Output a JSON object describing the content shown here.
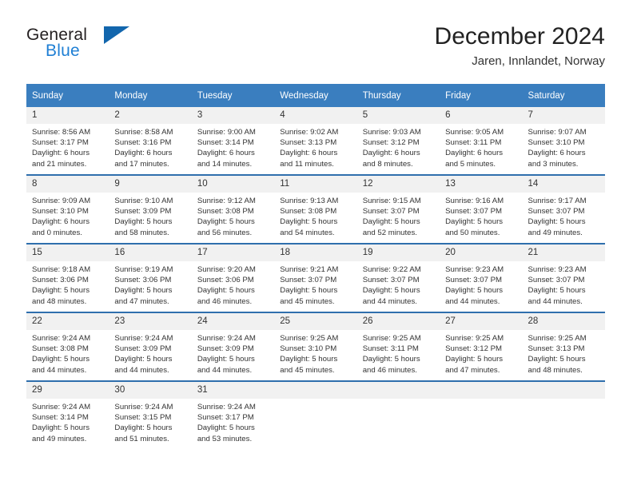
{
  "logo": {
    "text_top": "General",
    "text_bottom": "Blue",
    "triangle_icon": "blue-triangle-icon",
    "accent_color": "#1f7fd4"
  },
  "header": {
    "title": "December 2024",
    "subtitle": "Jaren, Innlandet, Norway"
  },
  "colors": {
    "header_row": "#3a7ebf",
    "week_divider": "#2f6fad",
    "daynum_band": "#f1f1f1",
    "text": "#333333"
  },
  "weekday_headers": [
    "Sunday",
    "Monday",
    "Tuesday",
    "Wednesday",
    "Thursday",
    "Friday",
    "Saturday"
  ],
  "weeks": [
    [
      {
        "day": "1",
        "sunrise": "Sunrise: 8:56 AM",
        "sunset": "Sunset: 3:17 PM",
        "daylight_line1": "Daylight: 6 hours",
        "daylight_line2": "and 21 minutes."
      },
      {
        "day": "2",
        "sunrise": "Sunrise: 8:58 AM",
        "sunset": "Sunset: 3:16 PM",
        "daylight_line1": "Daylight: 6 hours",
        "daylight_line2": "and 17 minutes."
      },
      {
        "day": "3",
        "sunrise": "Sunrise: 9:00 AM",
        "sunset": "Sunset: 3:14 PM",
        "daylight_line1": "Daylight: 6 hours",
        "daylight_line2": "and 14 minutes."
      },
      {
        "day": "4",
        "sunrise": "Sunrise: 9:02 AM",
        "sunset": "Sunset: 3:13 PM",
        "daylight_line1": "Daylight: 6 hours",
        "daylight_line2": "and 11 minutes."
      },
      {
        "day": "5",
        "sunrise": "Sunrise: 9:03 AM",
        "sunset": "Sunset: 3:12 PM",
        "daylight_line1": "Daylight: 6 hours",
        "daylight_line2": "and 8 minutes."
      },
      {
        "day": "6",
        "sunrise": "Sunrise: 9:05 AM",
        "sunset": "Sunset: 3:11 PM",
        "daylight_line1": "Daylight: 6 hours",
        "daylight_line2": "and 5 minutes."
      },
      {
        "day": "7",
        "sunrise": "Sunrise: 9:07 AM",
        "sunset": "Sunset: 3:10 PM",
        "daylight_line1": "Daylight: 6 hours",
        "daylight_line2": "and 3 minutes."
      }
    ],
    [
      {
        "day": "8",
        "sunrise": "Sunrise: 9:09 AM",
        "sunset": "Sunset: 3:10 PM",
        "daylight_line1": "Daylight: 6 hours",
        "daylight_line2": "and 0 minutes."
      },
      {
        "day": "9",
        "sunrise": "Sunrise: 9:10 AM",
        "sunset": "Sunset: 3:09 PM",
        "daylight_line1": "Daylight: 5 hours",
        "daylight_line2": "and 58 minutes."
      },
      {
        "day": "10",
        "sunrise": "Sunrise: 9:12 AM",
        "sunset": "Sunset: 3:08 PM",
        "daylight_line1": "Daylight: 5 hours",
        "daylight_line2": "and 56 minutes."
      },
      {
        "day": "11",
        "sunrise": "Sunrise: 9:13 AM",
        "sunset": "Sunset: 3:08 PM",
        "daylight_line1": "Daylight: 5 hours",
        "daylight_line2": "and 54 minutes."
      },
      {
        "day": "12",
        "sunrise": "Sunrise: 9:15 AM",
        "sunset": "Sunset: 3:07 PM",
        "daylight_line1": "Daylight: 5 hours",
        "daylight_line2": "and 52 minutes."
      },
      {
        "day": "13",
        "sunrise": "Sunrise: 9:16 AM",
        "sunset": "Sunset: 3:07 PM",
        "daylight_line1": "Daylight: 5 hours",
        "daylight_line2": "and 50 minutes."
      },
      {
        "day": "14",
        "sunrise": "Sunrise: 9:17 AM",
        "sunset": "Sunset: 3:07 PM",
        "daylight_line1": "Daylight: 5 hours",
        "daylight_line2": "and 49 minutes."
      }
    ],
    [
      {
        "day": "15",
        "sunrise": "Sunrise: 9:18 AM",
        "sunset": "Sunset: 3:06 PM",
        "daylight_line1": "Daylight: 5 hours",
        "daylight_line2": "and 48 minutes."
      },
      {
        "day": "16",
        "sunrise": "Sunrise: 9:19 AM",
        "sunset": "Sunset: 3:06 PM",
        "daylight_line1": "Daylight: 5 hours",
        "daylight_line2": "and 47 minutes."
      },
      {
        "day": "17",
        "sunrise": "Sunrise: 9:20 AM",
        "sunset": "Sunset: 3:06 PM",
        "daylight_line1": "Daylight: 5 hours",
        "daylight_line2": "and 46 minutes."
      },
      {
        "day": "18",
        "sunrise": "Sunrise: 9:21 AM",
        "sunset": "Sunset: 3:07 PM",
        "daylight_line1": "Daylight: 5 hours",
        "daylight_line2": "and 45 minutes."
      },
      {
        "day": "19",
        "sunrise": "Sunrise: 9:22 AM",
        "sunset": "Sunset: 3:07 PM",
        "daylight_line1": "Daylight: 5 hours",
        "daylight_line2": "and 44 minutes."
      },
      {
        "day": "20",
        "sunrise": "Sunrise: 9:23 AM",
        "sunset": "Sunset: 3:07 PM",
        "daylight_line1": "Daylight: 5 hours",
        "daylight_line2": "and 44 minutes."
      },
      {
        "day": "21",
        "sunrise": "Sunrise: 9:23 AM",
        "sunset": "Sunset: 3:07 PM",
        "daylight_line1": "Daylight: 5 hours",
        "daylight_line2": "and 44 minutes."
      }
    ],
    [
      {
        "day": "22",
        "sunrise": "Sunrise: 9:24 AM",
        "sunset": "Sunset: 3:08 PM",
        "daylight_line1": "Daylight: 5 hours",
        "daylight_line2": "and 44 minutes."
      },
      {
        "day": "23",
        "sunrise": "Sunrise: 9:24 AM",
        "sunset": "Sunset: 3:09 PM",
        "daylight_line1": "Daylight: 5 hours",
        "daylight_line2": "and 44 minutes."
      },
      {
        "day": "24",
        "sunrise": "Sunrise: 9:24 AM",
        "sunset": "Sunset: 3:09 PM",
        "daylight_line1": "Daylight: 5 hours",
        "daylight_line2": "and 44 minutes."
      },
      {
        "day": "25",
        "sunrise": "Sunrise: 9:25 AM",
        "sunset": "Sunset: 3:10 PM",
        "daylight_line1": "Daylight: 5 hours",
        "daylight_line2": "and 45 minutes."
      },
      {
        "day": "26",
        "sunrise": "Sunrise: 9:25 AM",
        "sunset": "Sunset: 3:11 PM",
        "daylight_line1": "Daylight: 5 hours",
        "daylight_line2": "and 46 minutes."
      },
      {
        "day": "27",
        "sunrise": "Sunrise: 9:25 AM",
        "sunset": "Sunset: 3:12 PM",
        "daylight_line1": "Daylight: 5 hours",
        "daylight_line2": "and 47 minutes."
      },
      {
        "day": "28",
        "sunrise": "Sunrise: 9:25 AM",
        "sunset": "Sunset: 3:13 PM",
        "daylight_line1": "Daylight: 5 hours",
        "daylight_line2": "and 48 minutes."
      }
    ],
    [
      {
        "day": "29",
        "sunrise": "Sunrise: 9:24 AM",
        "sunset": "Sunset: 3:14 PM",
        "daylight_line1": "Daylight: 5 hours",
        "daylight_line2": "and 49 minutes."
      },
      {
        "day": "30",
        "sunrise": "Sunrise: 9:24 AM",
        "sunset": "Sunset: 3:15 PM",
        "daylight_line1": "Daylight: 5 hours",
        "daylight_line2": "and 51 minutes."
      },
      {
        "day": "31",
        "sunrise": "Sunrise: 9:24 AM",
        "sunset": "Sunset: 3:17 PM",
        "daylight_line1": "Daylight: 5 hours",
        "daylight_line2": "and 53 minutes."
      },
      {
        "day": "",
        "sunrise": "",
        "sunset": "",
        "daylight_line1": "",
        "daylight_line2": ""
      },
      {
        "day": "",
        "sunrise": "",
        "sunset": "",
        "daylight_line1": "",
        "daylight_line2": ""
      },
      {
        "day": "",
        "sunrise": "",
        "sunset": "",
        "daylight_line1": "",
        "daylight_line2": ""
      },
      {
        "day": "",
        "sunrise": "",
        "sunset": "",
        "daylight_line1": "",
        "daylight_line2": ""
      }
    ]
  ]
}
